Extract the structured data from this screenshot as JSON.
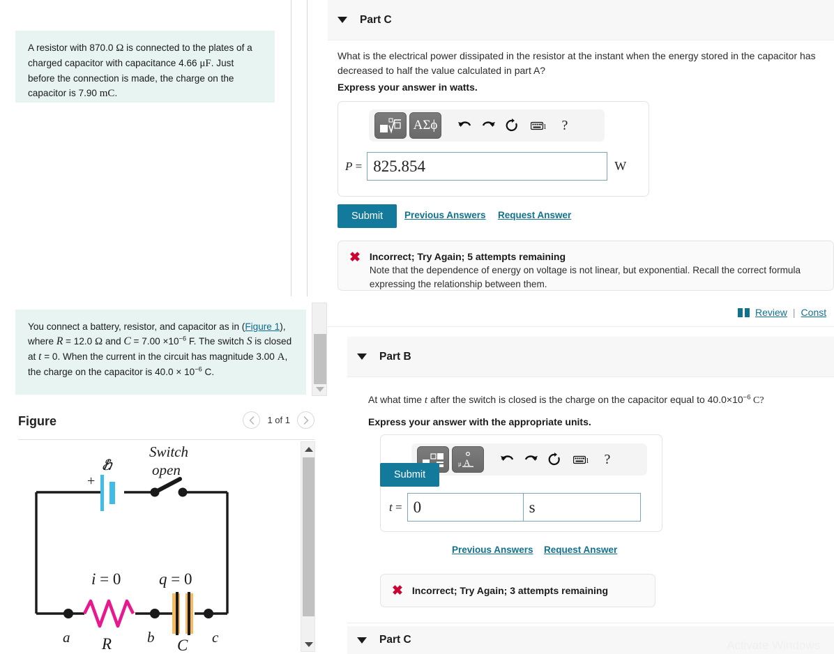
{
  "problems": {
    "a": {
      "line1": "A resistor with 870.0 ",
      "ohm": "Ω",
      "line2": " is connected to the plates of a charged capacitor with capacitance 4.66 ",
      "microfarad": "μF",
      "line3": ". Just before the connection is made, the charge on the capacitor is 7.90 ",
      "mc": "mC",
      "line4": "."
    },
    "b": {
      "t1": "You connect a battery, resistor, and capacitor as in (",
      "figure_link": "Figure 1",
      "t2": "), where ",
      "R": "R",
      "t3": " = 12.0 ",
      "ohm": "Ω",
      "t4": " and ",
      "C": "C",
      "t5": " = 7.00 ×10",
      "exp1": "−6",
      "t6": " F. The switch ",
      "S": "S",
      "t7": " is closed at ",
      "tvar": "t",
      "t8": " = 0. When the current in the circuit has magnitude 3.00 ",
      "A": "A",
      "t9": ", the charge on the capacitor is 40.0 × 10",
      "exp2": "−6",
      "t10": " C."
    }
  },
  "figure": {
    "title": "Figure",
    "counter": "1 of 1",
    "prev_icon": "chevron-left-icon",
    "next_icon": "chevron-right-icon",
    "circuit": {
      "emf_label": "ℰ",
      "plus_label": "+",
      "switch_line1": "Switch",
      "switch_line2": "open",
      "current_label": "i = 0",
      "charge_label": "q = 0",
      "node_a": "a",
      "node_b": "b",
      "node_c": "c",
      "resistor_label": "R",
      "capacitor_label": "C",
      "battery_color": "#3fbce8",
      "resistor_color": "#e8188f",
      "capacitor_color": "#f5bb63",
      "wire_color": "#1a1a1a"
    }
  },
  "part_c": {
    "label": "Part C",
    "caret_icon": "caret-down-icon",
    "question": "What is the electrical power dissipated in the resistor at the instant when the energy stored in the capacitor has decreased to half the value calculated in part A?",
    "instruction": "Express your answer in watts.",
    "toolbar": {
      "template_button": "sqrt-template-icon",
      "greek_button": "ΑΣϕ",
      "undo_icon": "undo-arrow-icon",
      "redo_icon": "redo-arrow-icon",
      "reset_icon": "reset-circle-icon",
      "keyboard_icon": "keyboard-icon",
      "keyboard_badge": "l",
      "help_icon": "?"
    },
    "answer": {
      "prefix_symbol": "P",
      "prefix_eq": "=",
      "value": "825.854",
      "unit": "W"
    },
    "submit_label": "Submit",
    "previous_answers": "Previous Answers",
    "request_answer": "Request Answer",
    "feedback": {
      "x_icon": "x-mark-icon",
      "title": "Incorrect; Try Again; 5 attempts remaining",
      "body": "Note that the dependence of energy on voltage is not linear, but exponential. Recall the correct formula expressing the relationship between them."
    }
  },
  "review_bar": {
    "book_icon": "book-icon",
    "review_label": "Review",
    "separator": "|",
    "constants_label": "Const"
  },
  "part_b": {
    "label": "Part B",
    "caret_icon": "caret-down-icon",
    "question_pre": "At what time ",
    "question_var": "t",
    "question_mid": " after the switch is closed is the charge on the capacitor equal to 40.0×10",
    "question_exp": "−6",
    "question_post": " C?",
    "instruction": "Express your answer with the appropriate units.",
    "toolbar": {
      "template_button": "blocks-template-icon",
      "units_button": "units-mu-A-icon",
      "undo_icon": "undo-arrow-icon",
      "redo_icon": "redo-arrow-icon",
      "reset_icon": "reset-circle-icon",
      "keyboard_icon": "keyboard-icon",
      "keyboard_badge": "l",
      "help_icon": "?"
    },
    "answer": {
      "prefix_symbol": "t",
      "prefix_eq": "=",
      "value": "0",
      "unit_value": "s"
    },
    "submit_label": "Submit",
    "previous_answers": "Previous Answers",
    "request_answer": "Request Answer",
    "feedback": {
      "x_icon": "x-mark-icon",
      "title": "Incorrect; Try Again; 3 attempts remaining"
    }
  },
  "part_c_bottom": {
    "label": "Part C",
    "caret_icon": "caret-down-icon"
  },
  "watermark": {
    "line1": "Activate Windows"
  },
  "colors": {
    "accent_teal": "#147a9c",
    "link_teal": "#10728f",
    "problem_bg": "#e8f4f2",
    "error_red": "#cc0033"
  }
}
